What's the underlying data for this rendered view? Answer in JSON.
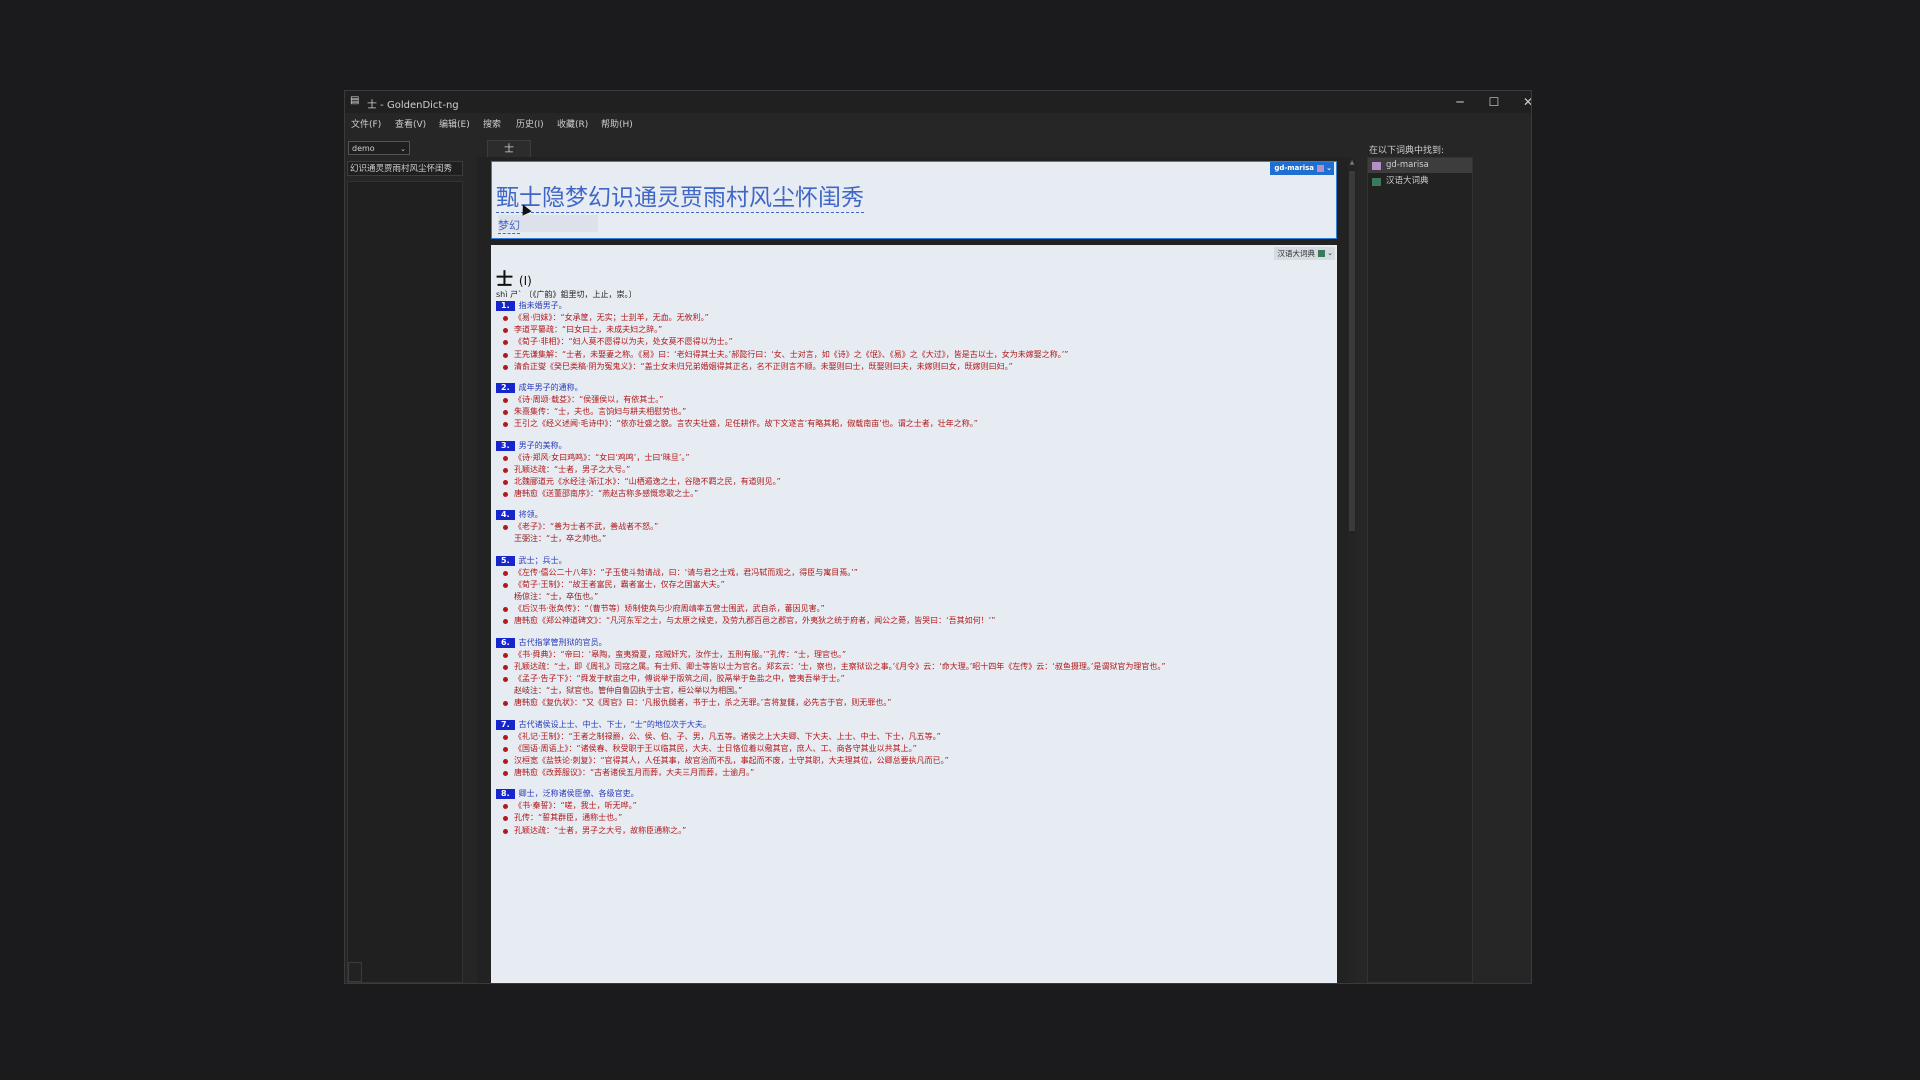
{
  "window": {
    "title": "士 - GoldenDict-ng"
  },
  "window_controls": {
    "minimize": "─",
    "maximize": "☐",
    "close": "✕"
  },
  "menu": [
    "文件(F)",
    "查看(V)",
    "编辑(E)",
    "搜索",
    "历史(I)",
    "收藏(R)",
    "帮助(H)"
  ],
  "left": {
    "group": "demo",
    "search_text": "幻识通灵贾雨村风尘怀闺秀"
  },
  "tab": {
    "label": "士"
  },
  "article1": {
    "dict_badge": "gd-marisa",
    "headword": "甄士隐梦幻识通灵贾雨村风尘怀闺秀",
    "sub": "梦幻"
  },
  "article2": {
    "dict_badge": "汉语大词典",
    "title": "士",
    "title_num": "(I)",
    "pron": "shì ㄕˋ 〔《广韵》鉏里切，上止，崇。〕",
    "senses": [
      {
        "num": "1.",
        "def": "指未婚男子。",
        "examples": [
          {
            "text": "《易·归妹》：“女承筐，无实；士刲羊，无血。无攸利。”",
            "note": false
          },
          {
            "text": "李道平纂疏：“曰女曰士，未成夫妇之辞。”",
            "note": false
          },
          {
            "text": "《荀子·非相》：“妇人莫不愿得以为夫，处女莫不愿得以为士。”",
            "note": false
          },
          {
            "text": "王先谦集解：“士者，未娶妻之称。《易》曰：‘老妇得其士夫。’郝懿行曰：‘女、士对言，如《诗》之《氓》、《易》之《大过》，皆是古以士，女为未嫁娶之称。’”",
            "note": false
          },
          {
            "text": "清俞正燮《癸巳类稿·阴为冤鬼义》：“盖士女未归兄弟婚姻得其正名，名不正则言不顺。未娶则曰士，既娶则曰夫，未嫁则曰女，既嫁则曰妇。”",
            "note": false
          }
        ]
      },
      {
        "num": "2.",
        "def": "成年男子的通称。",
        "examples": [
          {
            "text": "《诗·周颂·载芟》：“侯彊侯以，有依其士。”",
            "note": false
          },
          {
            "text": "朱熹集传：“士，夫也。言饷妇与耕夫相慰劳也。”",
            "note": false
          },
          {
            "text": "王引之《经义述闻·毛诗中》：“依亦壮盛之貌。言农夫壮盛，足任耕作。故下文遂言‘有略其耜，俶载南亩’也。谓之士者，壮年之称。”",
            "note": false
          }
        ]
      },
      {
        "num": "3.",
        "def": "男子的美称。",
        "examples": [
          {
            "text": "《诗·郑风·女曰鸡鸣》：“女曰‘鸡鸣’，士曰‘昧旦’。”",
            "note": false
          },
          {
            "text": "孔颖达疏：“士者，男子之大号。”",
            "note": false
          },
          {
            "text": "北魏郦道元《水经注·渐江水》：“山栖遁逸之士，谷隐不羁之民，有道则见。”",
            "note": false
          },
          {
            "text": "唐韩愈《送董邵南序》：“燕赵古称多感慨悲歌之士。”",
            "note": false
          }
        ]
      },
      {
        "num": "4.",
        "def": "将领。",
        "examples": [
          {
            "text": "《老子》：“善为士者不武，善战者不怒。”",
            "note": false
          },
          {
            "text": "王弼注：“士，卒之帅也。”",
            "note": true
          }
        ]
      },
      {
        "num": "5.",
        "def": "武士；兵士。",
        "examples": [
          {
            "text": "《左传·僖公二十八年》：“子玉使斗勃请战，曰：‘请与君之士戏，君冯轼而观之，得臣与寓目焉。’”",
            "note": false
          },
          {
            "text": "《荀子·王制》：“故王者富民，霸者富士，仅存之国富大夫。”",
            "note": false
          },
          {
            "text": "杨倞注：“士，卒伍也。”",
            "note": true
          },
          {
            "text": "《后汉书·张奂传》：“（曹节等）矫制使奂与少府周靖率五营士围武，武自杀，蕃因见害。”",
            "note": false
          },
          {
            "text": "唐韩愈《郑公神道碑文》：“凡河东军之士，与太原之候吏，及劳九郡百邑之郡官，外夷狄之统于府者，闻公之薨，皆哭曰：‘吾其如何！’”",
            "note": false
          }
        ]
      },
      {
        "num": "6.",
        "def": "古代指掌管刑狱的官员。",
        "examples": [
          {
            "text": "《书·舜典》：“帝曰：‘皋陶，蛮夷猾夏，寇贼奸宄，汝作士，五刑有服。’”孔传：“士，理官也。”",
            "note": false
          },
          {
            "text": "孔颖达疏：“士，即《周礼》司寇之属。有士师、卿士等皆以士为官名。郑玄云：‘士，察也，主察狱讼之事。’《月令》云：‘命大理。’昭十四年《左传》云：‘叔鱼摄理。’是谓狱官为理官也。”",
            "note": false
          },
          {
            "text": "《孟子·告子下》：“舜发于畎亩之中，傅说举于版筑之间，胶鬲举于鱼盐之中，管夷吾举于士。”",
            "note": false
          },
          {
            "text": "赵岐注：“士，狱官也。管仲自鲁囚执于士官，桓公举以为相国。”",
            "note": true
          },
          {
            "text": "唐韩愈《复仇状》：“又《周官》曰：‘凡报仇雠者，书于士，杀之无罪。’言将复雠，必先言于官，则无罪也。”",
            "note": false
          }
        ]
      },
      {
        "num": "7.",
        "def": "古代诸侯设上士、中士、下士，“士”的地位次于大夫。",
        "examples": [
          {
            "text": "《礼记·王制》：“王者之制禄爵，公、侯、伯、子、男，凡五等。诸侯之上大夫卿、下大夫、上士、中士、下士，凡五等。”",
            "note": false
          },
          {
            "text": "《国语·周语上》：“诸侯春、秋受职于王以临其民，大夫、士日恪位着以儆其官，庶人、工、商各守其业以共其上。”",
            "note": false
          },
          {
            "text": "汉桓宽《盐铁论·刺复》：“官得其人，人任其事，故官治而不乱，事起而不废，士守其职，大夫理其位，公卿总要执凡而已。”",
            "note": false
          },
          {
            "text": "唐韩愈《改葬服议》：“古者诸侯五月而葬，大夫三月而葬，士逾月。”",
            "note": false
          }
        ]
      },
      {
        "num": "8.",
        "def": "卿士，泛称诸侯臣僚、各级官吏。",
        "examples": [
          {
            "text": "《书·秦誓》：“嗟，我士，听无哗。”",
            "note": false
          },
          {
            "text": "孔传：“誓其群臣，通称士也。”",
            "note": false
          },
          {
            "text": "孔颖达疏：“士者，男子之大号，故称臣通称之。”",
            "note": false
          }
        ]
      }
    ]
  },
  "right": {
    "title": "在以下词典中找到:",
    "dicts": [
      {
        "name": "gd-marisa",
        "color": "#b88ec6",
        "selected": true
      },
      {
        "name": "汉语大词典",
        "color": "#3a7a5a",
        "selected": false
      }
    ]
  }
}
